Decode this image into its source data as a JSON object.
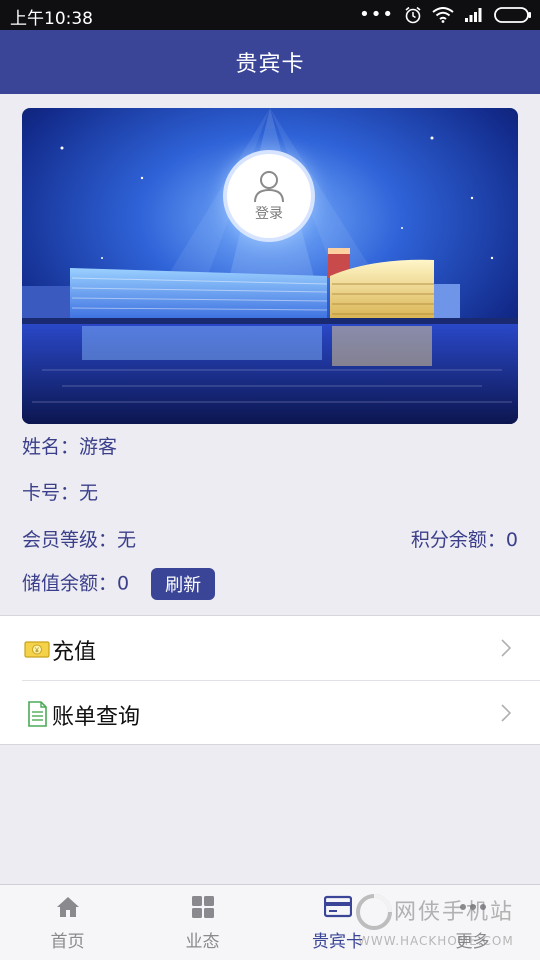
{
  "status_bar": {
    "time": "上午10:38",
    "icons": [
      "more-dots-icon",
      "alarm-icon",
      "wifi-icon",
      "signal-icon",
      "battery-icon"
    ]
  },
  "header": {
    "title": "贵宾卡"
  },
  "card": {
    "login_label": "登录",
    "image": "night-waterfront-building-illustration"
  },
  "info": {
    "name": "姓名：游客",
    "card_number": "卡号：无",
    "member_level": "会员等级：无",
    "points_balance": "积分余额：0",
    "stored_value": "储值余额：0",
    "refresh_label": "刷新"
  },
  "menu": [
    {
      "label": "充值",
      "icon": "money-icon"
    },
    {
      "label": "账单查询",
      "icon": "bill-document-icon"
    }
  ],
  "tabs": [
    {
      "label": "首页",
      "icon": "home-icon",
      "active": false
    },
    {
      "label": "业态",
      "icon": "grid-icon",
      "active": false
    },
    {
      "label": "贵宾卡",
      "icon": "card-icon",
      "active": true
    },
    {
      "label": "更多",
      "icon": "more-icon",
      "active": false
    }
  ],
  "watermark": {
    "text": "网侠手机站",
    "url": "WWW.HACKHOME.COM"
  },
  "colors": {
    "primary": "#3a4597",
    "background": "#ececf2"
  }
}
